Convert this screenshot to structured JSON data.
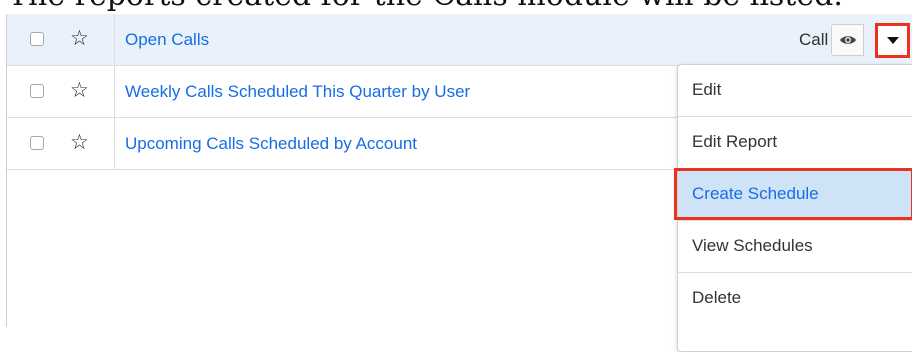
{
  "header": {
    "cut_heading": "The reports created for the Calls module will be listed."
  },
  "rows": [
    {
      "title": "Open Calls",
      "module": "Call",
      "selected": true
    },
    {
      "title": "Weekly Calls Scheduled This Quarter by User",
      "selected": false
    },
    {
      "title": "Upcoming Calls Scheduled by Account",
      "selected": false
    }
  ],
  "icons": {
    "star": "star-outline-icon",
    "preview": "eye-icon",
    "dropdown": "caret-down-icon"
  },
  "menu": {
    "items": [
      {
        "label": "Edit"
      },
      {
        "label": "Edit Report"
      },
      {
        "label": "Create Schedule",
        "active": true
      },
      {
        "label": "View Schedules"
      },
      {
        "label": "Delete"
      }
    ]
  },
  "colors": {
    "link": "#176de5",
    "highlight_border": "#e8331f",
    "selected_row": "#e9f2fb",
    "active_menu_item": "#cfe3f7"
  }
}
